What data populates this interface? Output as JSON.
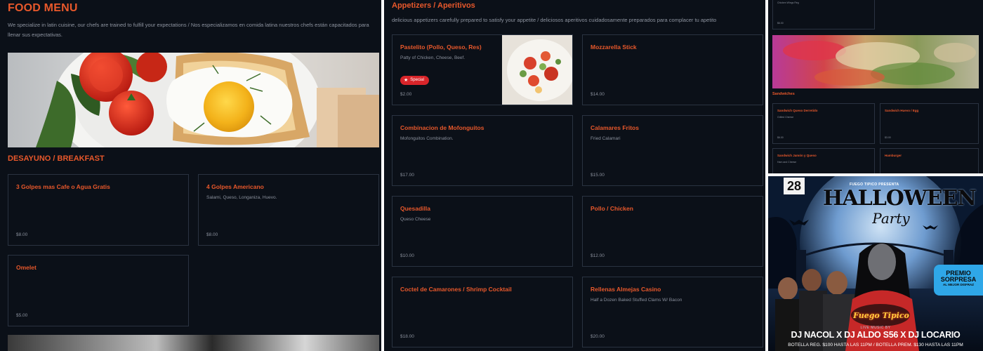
{
  "breakfast_panel": {
    "title": "FOOD MENU",
    "description": "We specialize in latin cuisine, our chefs are trained to fulfill your expectations / Nos especializamos en comida latina nuestros chefs están capacitados para llenar sus expectativas.",
    "section_title": "DESAYUNO / BREAKFAST",
    "items": [
      {
        "name": "3 Golpes mas Cafe o Agua Gratis",
        "desc": "",
        "price": "$8.00"
      },
      {
        "name": "4 Golpes Americano",
        "desc": "Salami, Queso, Longaniza, Huevo.",
        "price": "$8.00"
      },
      {
        "name": "Omelet",
        "desc": "",
        "price": "$5.00"
      }
    ]
  },
  "appetizer_panel": {
    "title": "Appetizers / Aperitivos",
    "description": "delicious appetizers carefully prepared to satisfy your appetite / deliciosos aperitivos cuidadosamente preparados para complacer tu apetito",
    "special_badge": "Special",
    "items": [
      {
        "name": "Pastelito (Pollo, Queso, Res)",
        "desc": "Patty of Chicken, Cheese, Beef.",
        "price": "$2.00"
      },
      {
        "name": "Mozzarella Stick",
        "desc": "",
        "price": "$14.00"
      },
      {
        "name": "Combinacion de Mofonguitos",
        "desc": "Mofonguitos Combination.",
        "price": "$17.00"
      },
      {
        "name": "Calamares Fritos",
        "desc": "Fried Calamari",
        "price": "$15.00"
      },
      {
        "name": "Quesadilla",
        "desc": "Queso Cheese",
        "price": "$10.00"
      },
      {
        "name": "Pollo / Chicken",
        "desc": "",
        "price": "$12.00"
      },
      {
        "name": "Coctel de Camarones / Shrimp Cocktail",
        "desc": "",
        "price": "$18.00"
      },
      {
        "name": "Rellenas Almejas Casino",
        "desc": "Half a Dozen Baked Stuffed Clams W/ Bacon",
        "price": "$20.00"
      }
    ]
  },
  "sandwich_panel": {
    "top_card": {
      "desc": "Chicken Wings Reg",
      "price": "$6.00"
    },
    "section_title": "Sandwiches",
    "items": [
      {
        "name": "Sandwich Queso Derretido",
        "desc": "Grilled Cheese",
        "price": "$6.00"
      },
      {
        "name": "Sandwich Huevo / Egg",
        "desc": "",
        "price": "$3.00"
      },
      {
        "name": "Sandwich Jamón y Queso",
        "desc": "Ham and Cheese",
        "price": ""
      },
      {
        "name": "Hamburger",
        "desc": "",
        "price": ""
      }
    ]
  },
  "flyer": {
    "date": "28",
    "presenter": "FUEGO TIPICO PRESENTA",
    "headline": "HALLOWEEN",
    "headline_script": "Party",
    "prize_line1": "PREMIO",
    "prize_line2": "SORPRESA",
    "prize_line3": "AL MEJOR DISFRAZ",
    "logo_text": "Fuego Tipico",
    "live_music": "LIVE MUSIC BY",
    "djs": "DJ NACOL X DJ ALDO S56 X DJ LOCARIO",
    "bottle_prices": "BOTELLA REG. $100 HASTA LAS 11PM / BOTELLA PREM. $130 HASTA LAS  11PM"
  },
  "colors": {
    "accent": "#e8582b",
    "background": "#0b1018",
    "card_border": "#2a3341",
    "badge": "#d9252a"
  }
}
